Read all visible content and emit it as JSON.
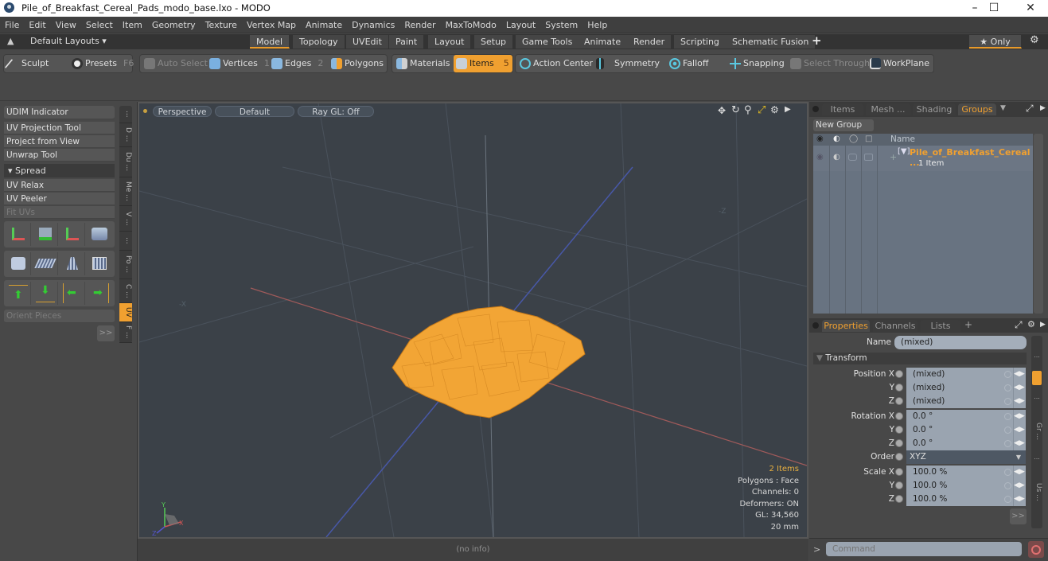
{
  "window": {
    "title": "Pile_of_Breakfast_Cereal_Pads_modo_base.lxo - MODO",
    "controls": {
      "minimize": "–",
      "maximize": "☐",
      "close": "✕"
    }
  },
  "menubar": [
    "File",
    "Edit",
    "View",
    "Select",
    "Item",
    "Geometry",
    "Texture",
    "Vertex Map",
    "Animate",
    "Dynamics",
    "Render",
    "MaxToModo",
    "Layout",
    "System",
    "Help"
  ],
  "layoutbar": {
    "layouts_label": "Default Layouts ▾",
    "tabs": [
      "Model",
      "Topology",
      "UVEdit",
      "Paint",
      "Layout",
      "Setup",
      "Game Tools",
      "Animate",
      "Render",
      "Scripting",
      "Schematic Fusion"
    ],
    "active_tab": "Model",
    "add_label": "+",
    "only_label": "★ Only",
    "gear": "⚙"
  },
  "toolbar": {
    "sculpt": "Sculpt",
    "presets": "Presets",
    "presets_key": "F6",
    "auto_select": "Auto Select",
    "vertices": "Vertices",
    "vertices_num": "1",
    "edges": "Edges",
    "edges_num": "2",
    "polygons": "Polygons",
    "materials": "Materials",
    "items": "Items",
    "items_num": "5",
    "action_center": "Action Center",
    "symmetry": "Symmetry",
    "falloff": "Falloff",
    "snapping": "Snapping",
    "select_through": "Select Through",
    "workplane": "WorkPlane"
  },
  "leftpanel": {
    "udim": "UDIM Indicator",
    "tools1": [
      "UV Projection Tool",
      "Project from View",
      "Unwrap Tool"
    ],
    "spread": "▾ Spread",
    "tools2": [
      "UV Relax",
      "UV Peeler",
      "Fit UVs"
    ],
    "orient": "Orient Pieces",
    "more": ">>",
    "sidetabs": [
      "...",
      "D ...",
      "Du ...",
      "Me ...",
      "V ...",
      "...",
      "Po ...",
      "C ...",
      "UV",
      "F ..."
    ]
  },
  "viewport": {
    "view_mode": "Perspective",
    "shading": "Default",
    "raygl": "Ray GL: Off",
    "info": {
      "items": "2 Items",
      "polygons": "Polygons : Face",
      "channels": "Channels: 0",
      "deformers": "Deformers: ON",
      "gl": "GL: 34,560",
      "unit": "20 mm"
    },
    "axis_labels": {
      "x": "X",
      "y": "Y",
      "z": "Z"
    },
    "model_color": "#f0a030"
  },
  "statusbar": {
    "text": "(no info)"
  },
  "groups_panel": {
    "tabs": [
      "Items",
      "Mesh ...",
      "Shading",
      "Groups"
    ],
    "active_tab": "Groups",
    "new_group": "New Group",
    "name_header": "Name",
    "group_name": "Pile_of_Breakfast_Cereal ...",
    "group_count": "1 Item"
  },
  "properties_panel": {
    "tabs": [
      "Properties",
      "Channels",
      "Lists"
    ],
    "active_tab": "Properties",
    "add": "+",
    "name_label": "Name",
    "name_value": "(mixed)",
    "section": "Transform",
    "rows": [
      {
        "label": "Position X",
        "value": "(mixed)"
      },
      {
        "label": "Y",
        "value": "(mixed)"
      },
      {
        "label": "Z",
        "value": "(mixed)"
      },
      {
        "label": "Rotation X",
        "value": "0.0 °"
      },
      {
        "label": "Y",
        "value": "0.0 °"
      },
      {
        "label": "Z",
        "value": "0.0 °"
      },
      {
        "label": "Order",
        "value": "XYZ"
      },
      {
        "label": "Scale X",
        "value": "100.0 %"
      },
      {
        "label": "Y",
        "value": "100.0 %"
      },
      {
        "label": "Z",
        "value": "100.0 %"
      }
    ],
    "more": ">>",
    "sidetabs": [
      "...",
      "",
      "...",
      "Gr ...",
      "...",
      "Us ..."
    ]
  },
  "command": {
    "prompt": ">",
    "placeholder": "Command"
  },
  "colors": {
    "accent": "#f0a030",
    "x_axis": "#b05a5a",
    "z_axis": "#4a5ab0"
  }
}
